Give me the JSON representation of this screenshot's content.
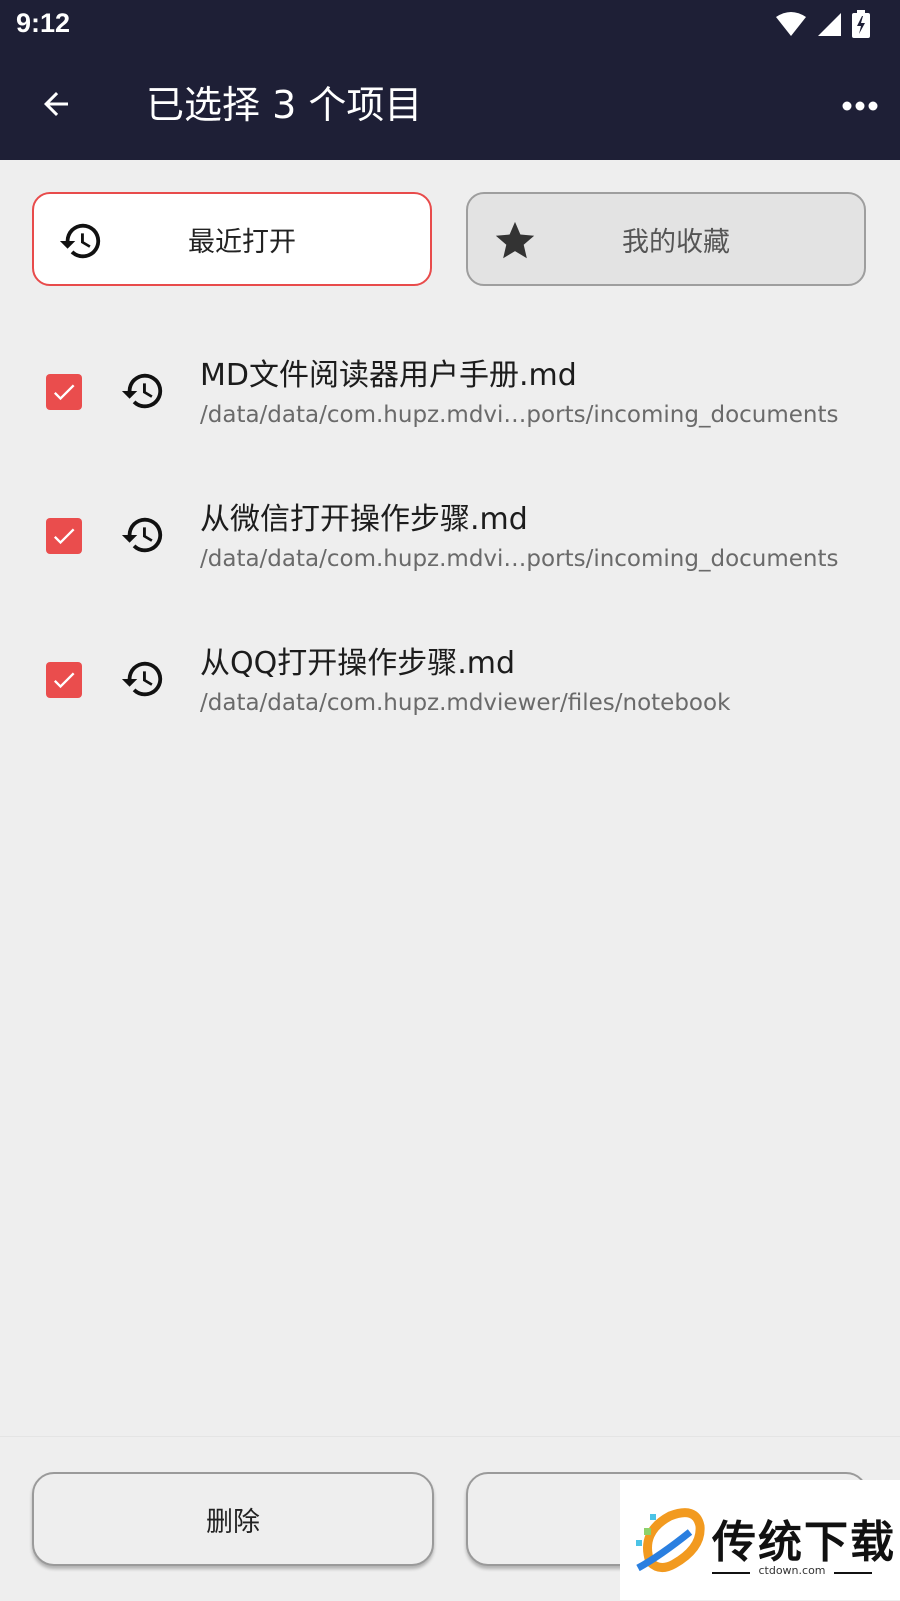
{
  "status_bar": {
    "time": "9:12",
    "icons": [
      "wifi-icon",
      "signal-icon",
      "battery-charging-icon"
    ]
  },
  "app_bar": {
    "title": "已选择 3 个项目",
    "back_icon": "arrow-left-icon",
    "more_icon": "more-horizontal-icon",
    "background": "#1e1f36"
  },
  "tabs": [
    {
      "label": "最近打开",
      "icon": "history-icon",
      "selected": true
    },
    {
      "label": "我的收藏",
      "icon": "star-icon",
      "selected": false
    }
  ],
  "items": [
    {
      "title": "MD文件阅读器用户手册.md",
      "path": "/data/data/com.hupz.mdvi…ports/incoming_documents",
      "checked": true,
      "icon": "history-icon"
    },
    {
      "title": "从微信打开操作步骤.md",
      "path": "/data/data/com.hupz.mdvi…ports/incoming_documents",
      "checked": true,
      "icon": "history-icon"
    },
    {
      "title": "从QQ打开操作步骤.md",
      "path": "/data/data/com.hupz.mdviewer/files/notebook",
      "checked": true,
      "icon": "history-icon"
    }
  ],
  "bottom_bar": {
    "delete_label": "删除",
    "second_label": ""
  },
  "watermark": {
    "text": "传统下载",
    "sub": "ctdown.com"
  },
  "colors": {
    "accent": "#ea4d4d",
    "background": "#eeeeee"
  }
}
